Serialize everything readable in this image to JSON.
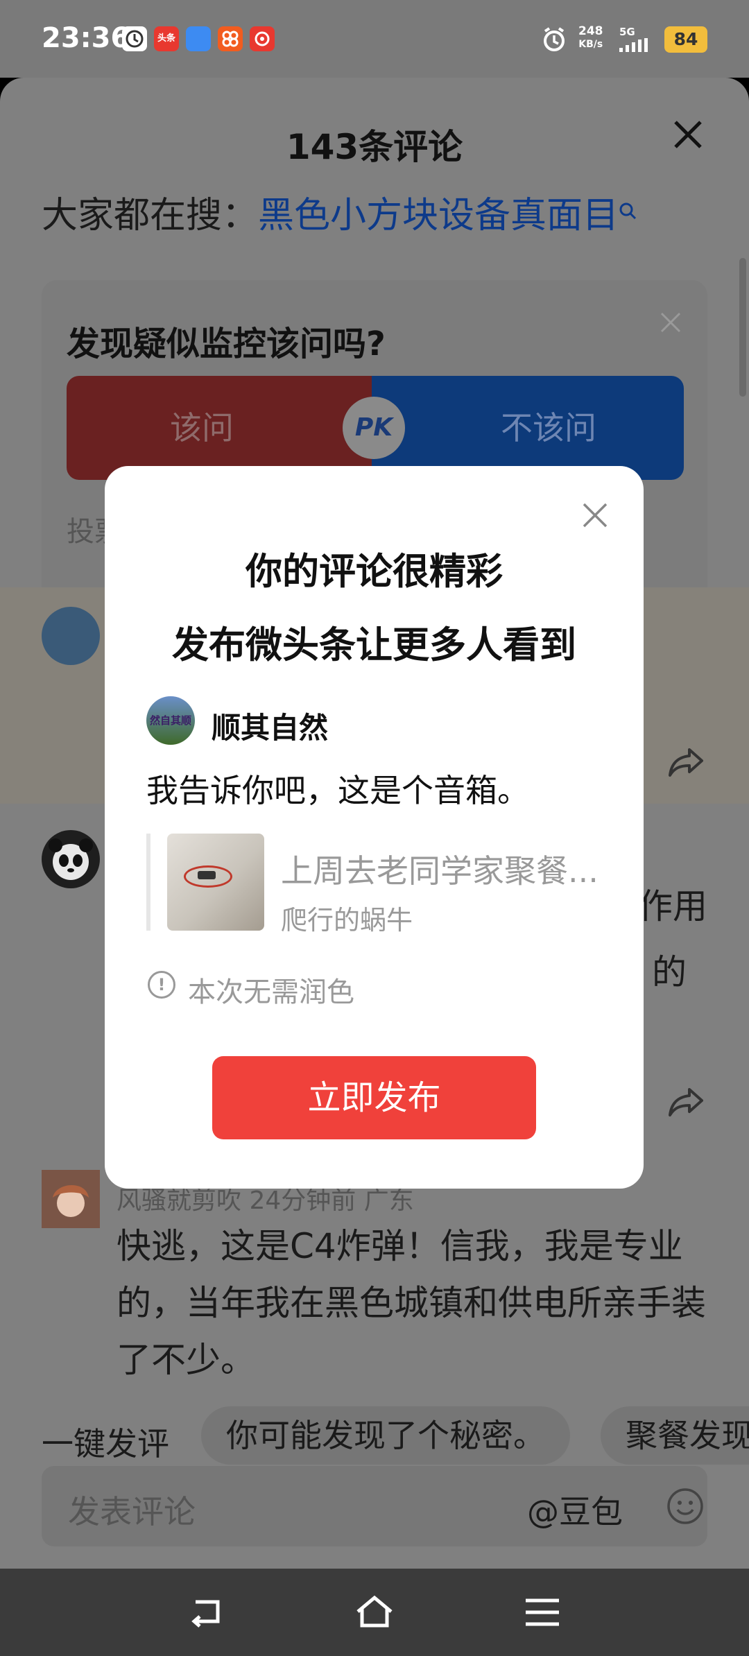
{
  "status_bar": {
    "time": "23:36",
    "app_icons": [
      {
        "name": "clock-app-icon",
        "label": "",
        "color": "#ffffff"
      },
      {
        "name": "toutiao-app-icon",
        "label": "头条",
        "color": "#e8382f"
      },
      {
        "name": "folder-app-icon",
        "label": "",
        "color": "#3d8bf2"
      },
      {
        "name": "grid-app-icon",
        "label": "",
        "color": "#f25c1f"
      },
      {
        "name": "music-app-icon",
        "label": "",
        "color": "#e8382f"
      }
    ],
    "net_speed_value": "248",
    "net_speed_unit": "KB/s",
    "signal_type": "5G",
    "battery": "84"
  },
  "sheet": {
    "title": "143条评论",
    "search_prefix": "大家都在搜：",
    "search_link": "黑色小方块设备真面目"
  },
  "poll": {
    "question": "发现疑似监控该问吗?",
    "option_left": "该问",
    "option_right": "不该问",
    "pk_label": "PK",
    "vote_text": "投票"
  },
  "comments_bg": {
    "fragment_1": "作用",
    "fragment_2": "的",
    "comment_3_meta": "风骚就剪吹  24分钟前  广东",
    "comment_3_text": "快逃，这是C4炸弹！信我，我是专业的，当年我在黑色城镇和供电所亲手装了不少。"
  },
  "quick_reply": {
    "label": "一键发评",
    "chips": [
      "你可能发现了个秘密。",
      "聚餐发现"
    ]
  },
  "input_bar": {
    "placeholder": "发表评论",
    "mention": "@豆包"
  },
  "dialog": {
    "title_line1": "你的评论很精彩",
    "title_line2": "发布微头条让更多人看到",
    "avatar_text": "然自其顺",
    "user_name": "顺其自然",
    "comment": "我告诉你吧，这是个音箱。",
    "ref_title": "上周去老同学家聚餐...",
    "ref_author": "爬行的蜗牛",
    "info_text": "本次无需润色",
    "publish_button": "立即发布"
  },
  "colors": {
    "accent_red": "#f0413b",
    "link_blue": "#0d3a8a",
    "battery_yellow": "#f2bd3c"
  }
}
